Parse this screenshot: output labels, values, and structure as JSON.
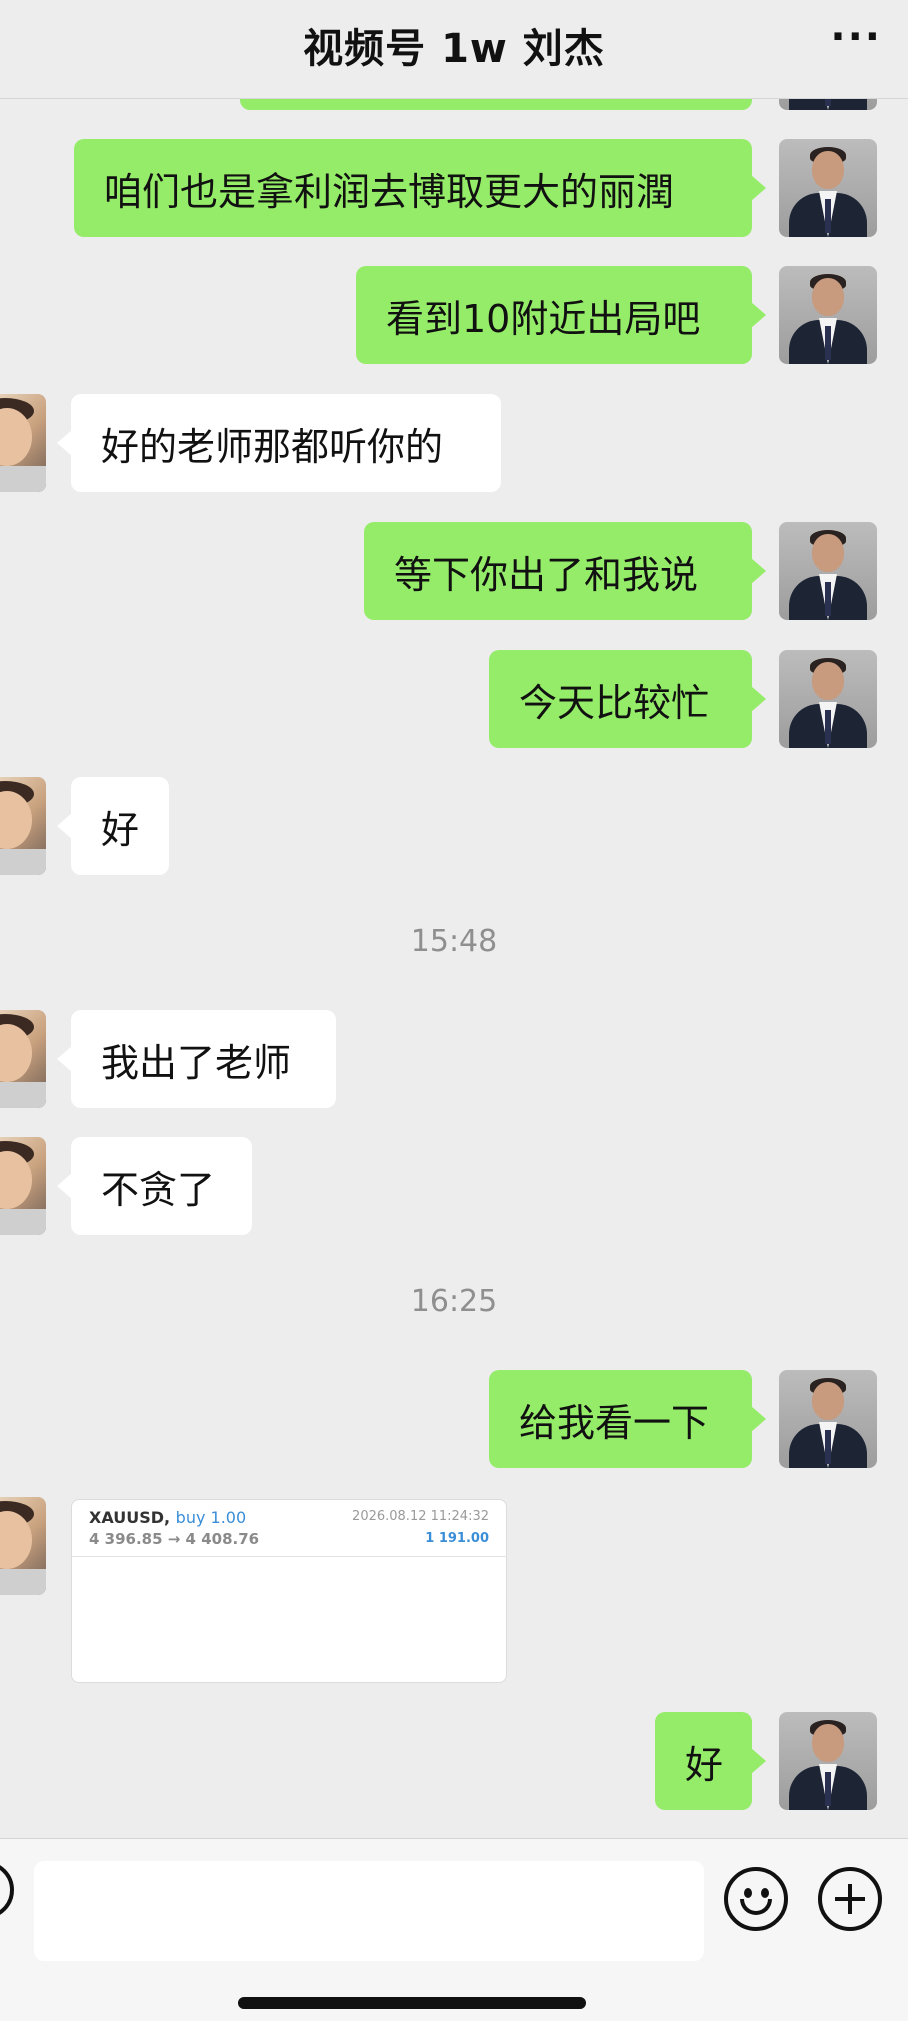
{
  "header": {
    "title": "视频号 1w 刘杰",
    "more_icon": "more-icon"
  },
  "messages": [
    {
      "type": "out",
      "text": "咱们也是拿利润去博取更大的丽潤"
    },
    {
      "type": "out",
      "text": "看到10附近出局吧"
    },
    {
      "type": "in",
      "text": "好的老师那都听你的"
    },
    {
      "type": "out",
      "text": "等下你出了和我说"
    },
    {
      "type": "out",
      "text": "今天比较忙"
    },
    {
      "type": "in",
      "text": "好"
    },
    {
      "type": "time",
      "text": "15:48"
    },
    {
      "type": "in",
      "text": "我出了老师"
    },
    {
      "type": "in",
      "text": "不贪了"
    },
    {
      "type": "time",
      "text": "16:25"
    },
    {
      "type": "out",
      "text": "给我看一下"
    },
    {
      "type": "out",
      "text": "好"
    }
  ],
  "trade_card": {
    "symbol": "XAUUSD,",
    "side": "buy 1.00",
    "prices": "4 396.85 → 4 408.76",
    "datetime": "2026.08.12 11:24:32",
    "profit": "1 191.00"
  },
  "input_bar": {
    "message_value": "",
    "voice_icon": "voice-icon",
    "emoji_icon": "emoji-icon",
    "add_icon": "plus-icon"
  },
  "colors": {
    "background": "#ededed",
    "outgoing_bubble": "#95ec69",
    "incoming_bubble": "#ffffff",
    "accent_blue": "#3a8ed8"
  }
}
